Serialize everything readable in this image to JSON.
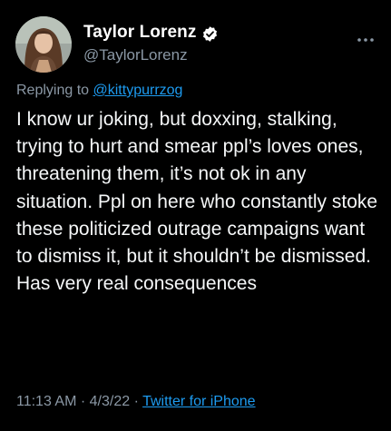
{
  "tweet": {
    "author": {
      "display_name": "Taylor Lorenz",
      "handle": "@TaylorLorenz",
      "verified": true,
      "avatar_icon": "profile-photo"
    },
    "replying_prefix": "Replying to ",
    "replying_to": "@kittypurrzog",
    "text": "I know ur joking, but doxxing, stalking, trying to hurt and smear ppl’s loves ones, threatening them, it’s not ok in any situation. Ppl on here who constantly stoke these politicized outrage campaigns want to dismiss it, but it shouldn’t be dismissed. Has very real consequences",
    "time": "11:13 AM",
    "separator1": " · ",
    "date": "4/3/22",
    "separator2": " · ",
    "source": "Twitter for iPhone"
  },
  "colors": {
    "background": "#000000",
    "text": "#e7e9ea",
    "secondary": "#8b98a5",
    "link": "#1d9bf0",
    "verified_badge": "#ffffff"
  },
  "icons": {
    "verified": "verified-badge-icon",
    "more": "more-options-icon"
  }
}
